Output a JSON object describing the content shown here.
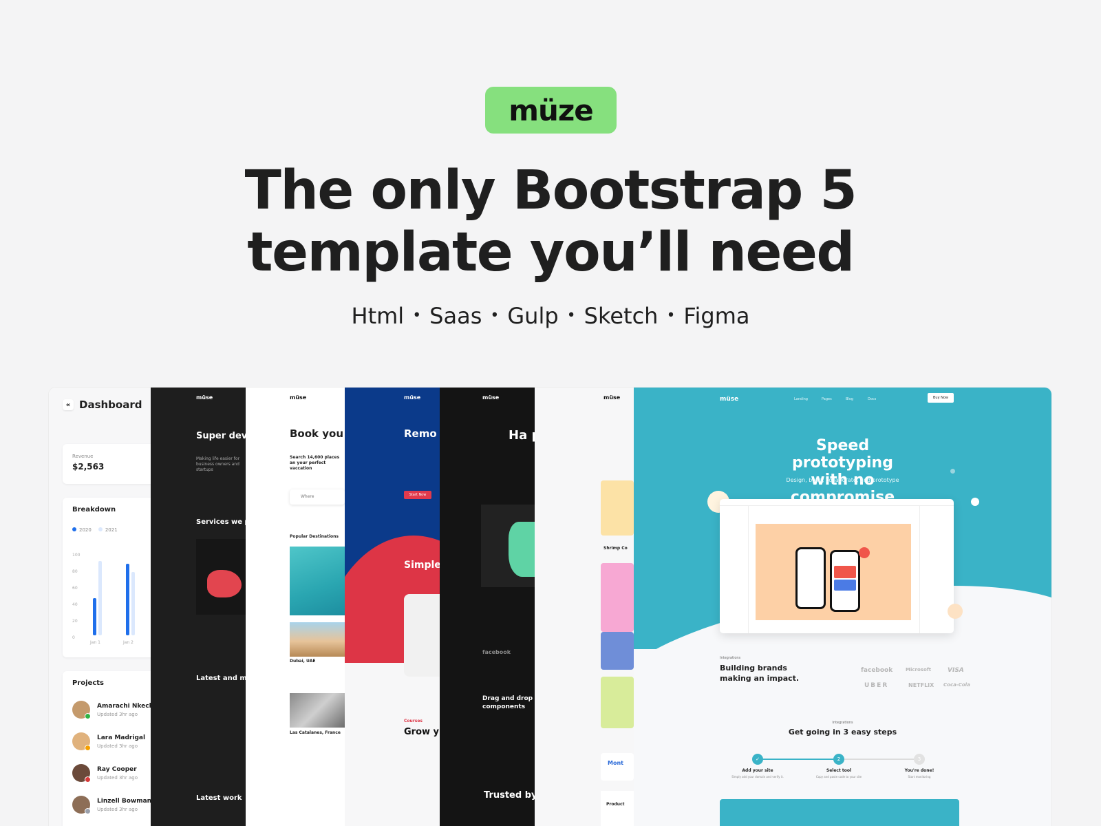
{
  "logo": {
    "text": "müze"
  },
  "headline": {
    "line1": "The only Bootstrap 5",
    "line2": "template you’ll need"
  },
  "tech": [
    "Html",
    "Saas",
    "Gulp",
    "Sketch",
    "Figma"
  ],
  "colors": {
    "background": "#f4f4f5",
    "logo_green": "#86e07e",
    "teal": "#3ab3c7",
    "blue": "#0b3a8a",
    "red": "#dd3546"
  },
  "dashboard": {
    "title": "Dashboard",
    "revenue_label": "Revenue",
    "revenue_value": "$2,563",
    "breakdown_title": "Breakdown",
    "legend": [
      "2020",
      "2021"
    ],
    "y_ticks": [
      "100",
      "80",
      "60",
      "40",
      "20",
      "0"
    ],
    "x_ticks": [
      "Jan 1",
      "Jan 2"
    ],
    "projects_title": "Projects",
    "projects": [
      {
        "name": "Amarachi Nkechi",
        "updated": "Updated 3hr ago",
        "status_color": "#2fb344"
      },
      {
        "name": "Lara Madrigal",
        "updated": "Updated 3hr ago",
        "status_color": "#f59f00"
      },
      {
        "name": "Ray Cooper",
        "updated": "Updated 3hr ago",
        "status_color": "#d63939"
      },
      {
        "name": "Linzell Bowman",
        "updated": "Updated 3hr ago",
        "status_color": "#9aa0ac"
      }
    ]
  },
  "agency": {
    "logo": "müse",
    "heading": "Super dev coding ag",
    "desc": "Making life easier for business owners and startups",
    "services": "Services we p",
    "section2": "Latest and m powerful tech",
    "latest": "Latest work"
  },
  "travel": {
    "logo": "müse",
    "heading": "Book you trip insta",
    "desc": "Search 14,600 places an your perfect vaccation",
    "search": "Where",
    "popular": "Popular Destinations",
    "city1": "Dubai, UAE",
    "city2": "Las Catalanes, France"
  },
  "course": {
    "logo": "müse",
    "heading": "Remo cours simpl",
    "button": "Start Now",
    "simple": "Simple",
    "courses_label": "Courses",
    "grow": "Grow y with 50"
  },
  "darkapp": {
    "logo": "müse",
    "heading": "Ha pow",
    "facebook": "facebook",
    "dragdrop": "Drag and drop components",
    "trusted": "Trusted by"
  },
  "shop": {
    "logo": "müse",
    "item": "Shrimp Co",
    "footer": "Mont",
    "product": "Product"
  },
  "main": {
    "brand": "müse",
    "nav": [
      "Landing",
      "Pages",
      "Blog",
      "Docs"
    ],
    "buy": "Buy Now",
    "title": "Speed prototyping with no compromise",
    "tagline": "Design, build, collaborate, and prototype",
    "integrations": "Integrations",
    "brands_heading": "Building brands making an impact.",
    "brands": [
      "facebook",
      "Microsoft",
      "VISA",
      "UBER",
      "NETFLIX",
      "Coca-Cola"
    ],
    "integrations2": "Integrations",
    "steps_heading": "Get going in 3 easy steps",
    "steps": [
      {
        "num": "✓",
        "label": "Add your site",
        "sub": "Simply add your domain and verify it."
      },
      {
        "num": "2",
        "label": "Select tool",
        "sub": "Copy and paste code to your site"
      },
      {
        "num": "3",
        "label": "You're done!",
        "sub": "Start monitoring"
      }
    ]
  }
}
